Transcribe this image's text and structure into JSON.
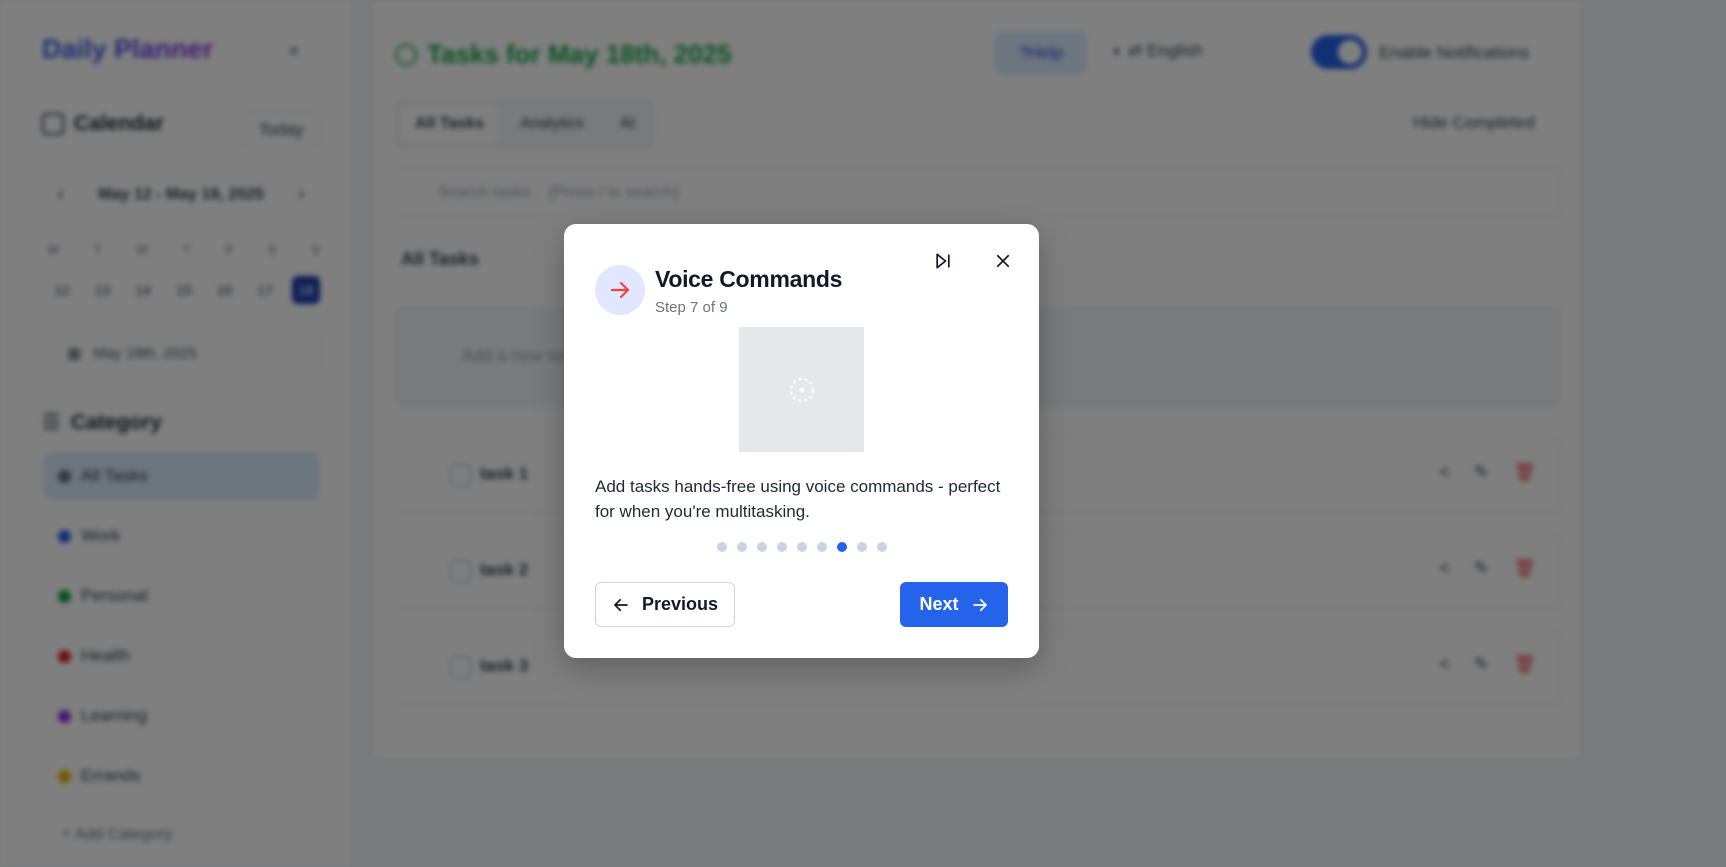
{
  "background": {
    "sidebar": {
      "brand": "Daily Planner",
      "calendar_title": "Calendar",
      "today_label": "Today",
      "week_range": "May 12 - May 18, 2025",
      "week_days": [
        "M",
        "T",
        "W",
        "T",
        "F",
        "S",
        "S"
      ],
      "week_dates": [
        "12",
        "13",
        "14",
        "15",
        "16",
        "17",
        "18"
      ],
      "selected_date": "May 18th, 2025",
      "category_title": "Category",
      "categories": [
        {
          "label": "All Tasks",
          "color": "#6b7280"
        },
        {
          "label": "Work",
          "color": "#2563eb"
        },
        {
          "label": "Personal",
          "color": "#16a34a"
        },
        {
          "label": "Health",
          "color": "#dc2626"
        },
        {
          "label": "Learning",
          "color": "#9333ea"
        },
        {
          "label": "Errands",
          "color": "#eab308"
        }
      ],
      "add_category": "Add Category"
    },
    "main": {
      "title": "Tasks for May 18th, 2025",
      "help_label": "Help",
      "language": "English",
      "notifications_label": "Enable Notifications",
      "tabs": [
        "All Tasks",
        "Analytics",
        "AI"
      ],
      "hide_completed": "Hide Completed",
      "search_placeholder": "Search tasks... (Press / to search)",
      "filter_label": "All Tasks",
      "add_task_placeholder": "Add a new task",
      "tasks": [
        "task 1",
        "task 2",
        "task 3"
      ]
    }
  },
  "tour": {
    "title": "Voice Commands",
    "step": "Step 7 of 9",
    "description": "Add tasks hands-free using voice commands - perfect for when you're multitasking.",
    "total_steps": 9,
    "current_step": 7,
    "previous_label": "Previous",
    "next_label": "Next",
    "accent_color": "#2563eb",
    "icon_color": "#ef4444"
  }
}
